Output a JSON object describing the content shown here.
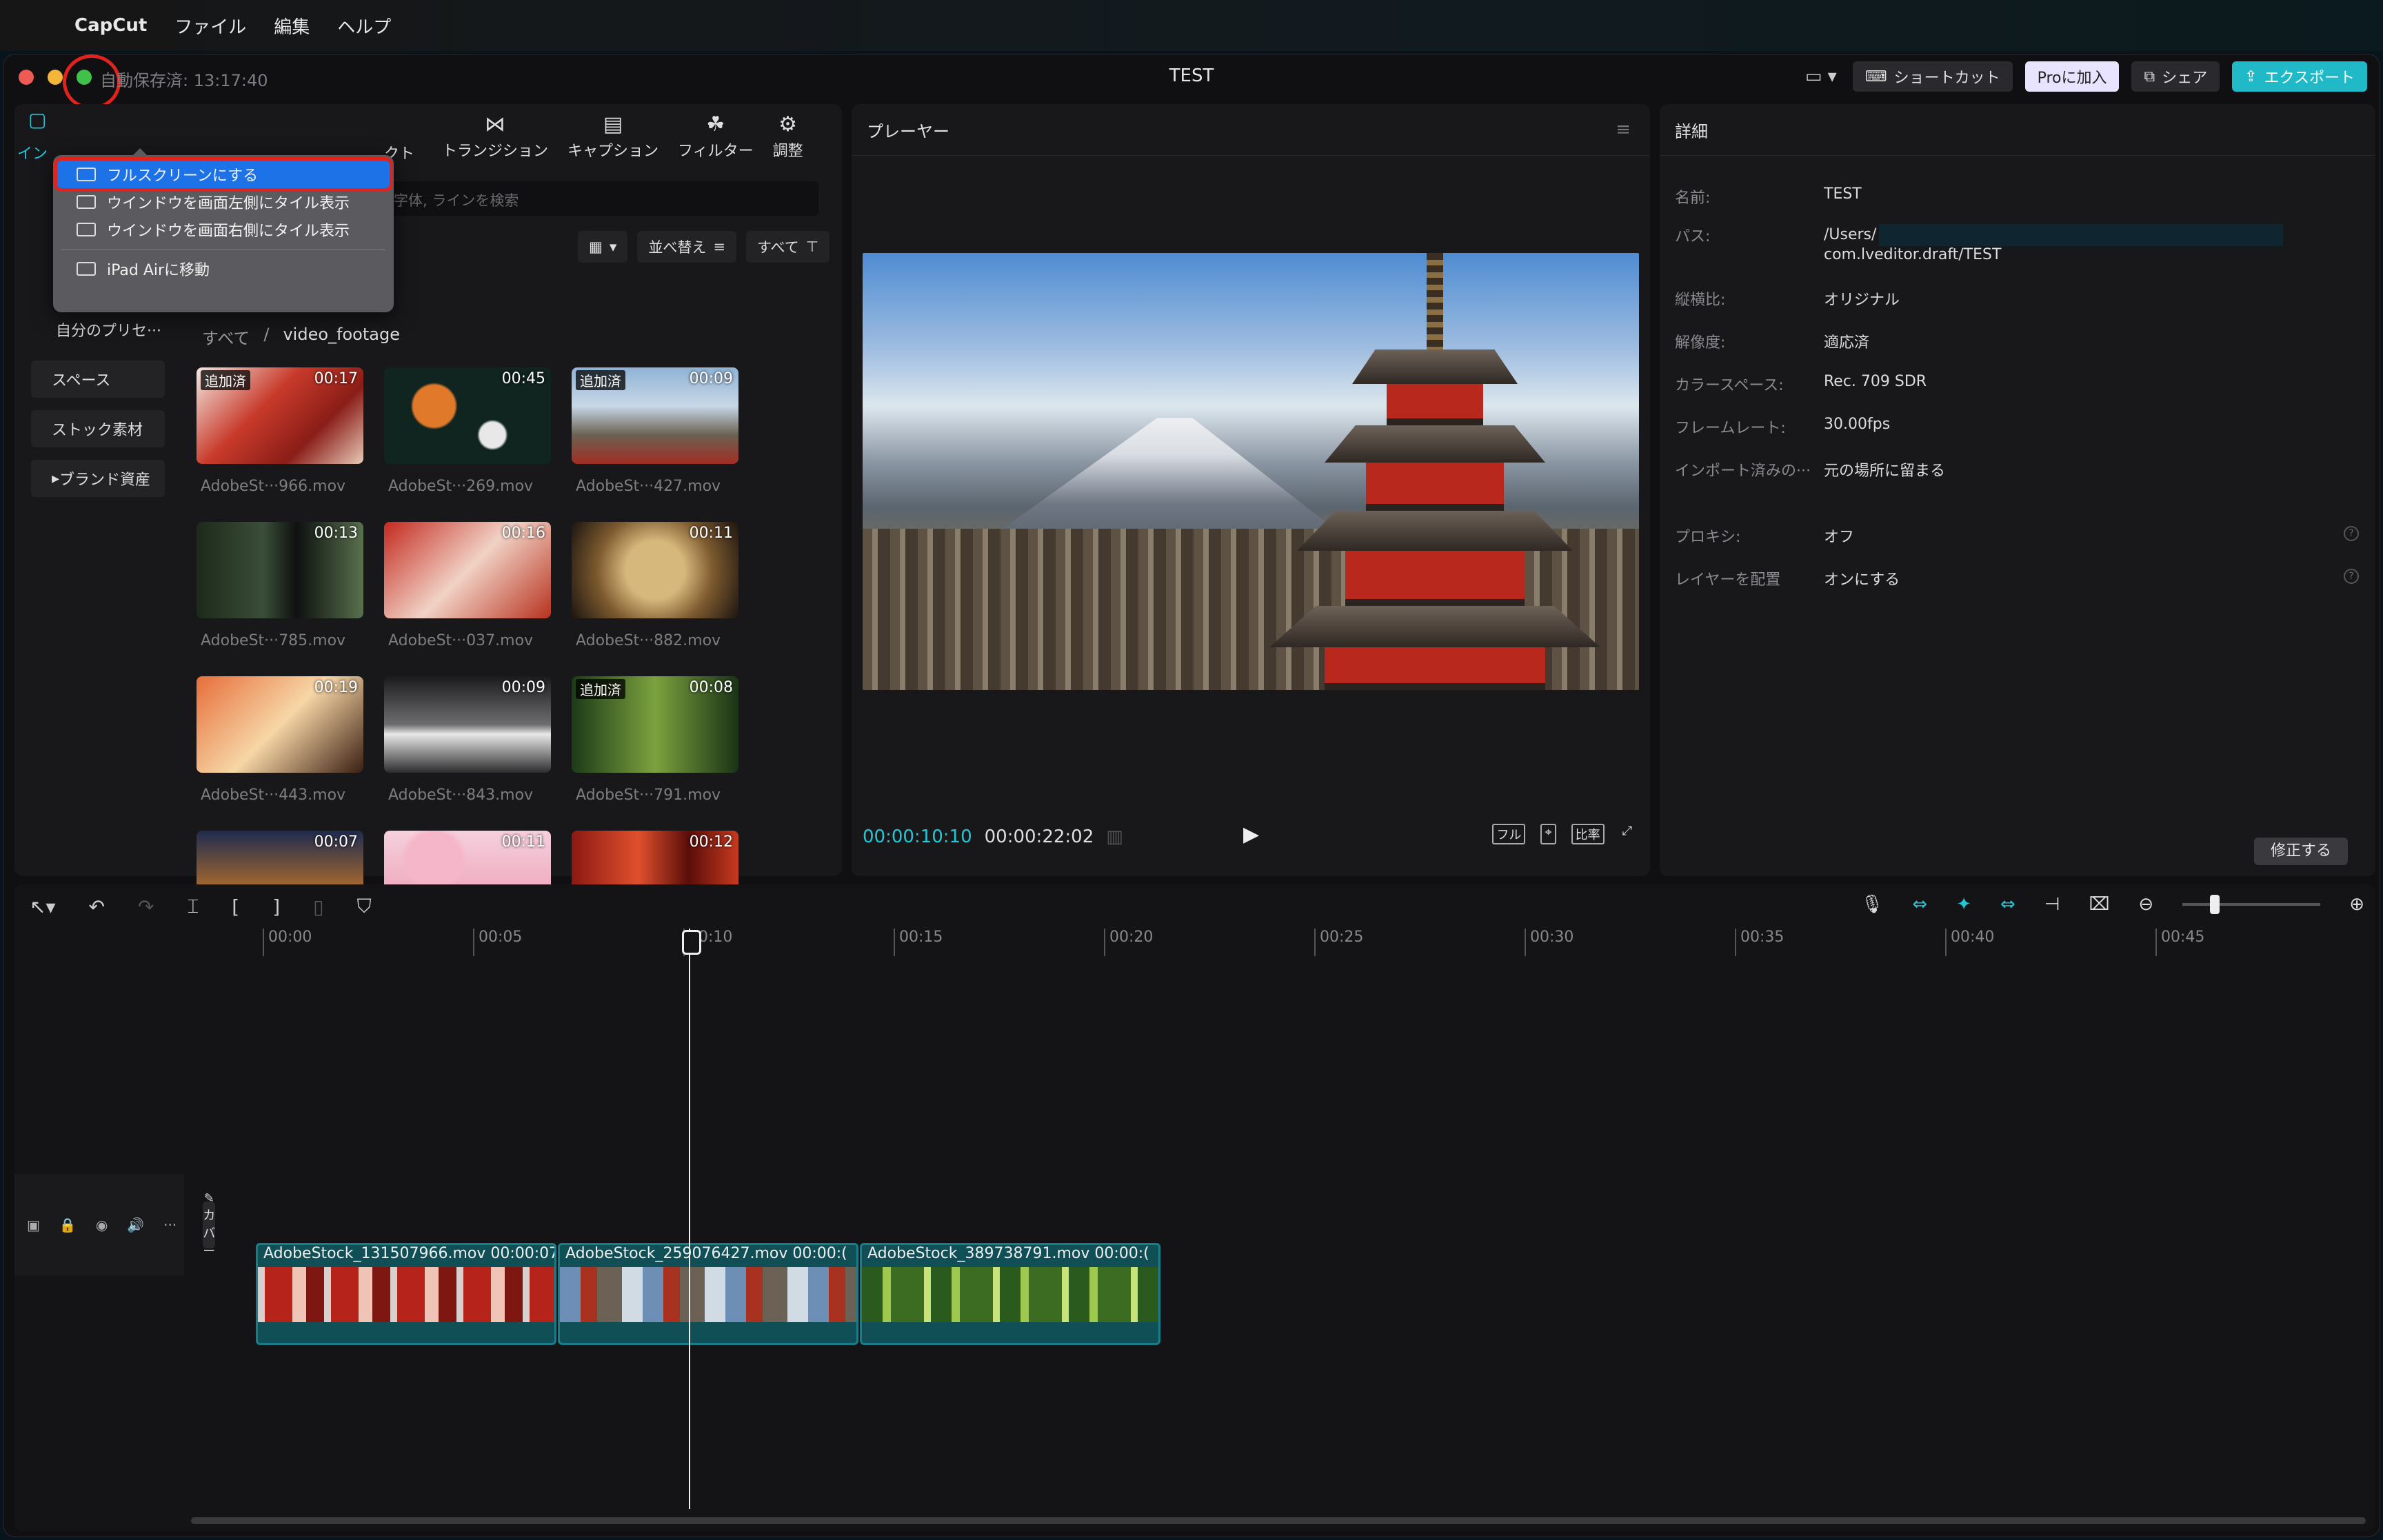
{
  "menubar": {
    "app_name": "CapCut",
    "items": [
      "ファイル",
      "編集",
      "ヘルプ"
    ]
  },
  "titlebar": {
    "autosave": "自動保存済: 13:17:40",
    "title": "TEST",
    "shortcut": "ショートカット",
    "pro": "Proに加入",
    "share": "シェア",
    "export": "エクスポート"
  },
  "window_menu": {
    "items": [
      {
        "label": "フルスクリーンにする",
        "active": true
      },
      {
        "label": "ウインドウを画面左側にタイル表示",
        "active": false
      },
      {
        "label": "ウインドウを画面右側にタイル表示",
        "active": false
      },
      {
        "label": "iPad Airに移動",
        "active": false
      }
    ]
  },
  "media_panel": {
    "tabs": [
      {
        "label": "トランジション",
        "icon": "transition-icon"
      },
      {
        "label": "キャプション",
        "icon": "caption-icon"
      },
      {
        "label": "フィルター",
        "icon": "filter-icon"
      },
      {
        "label": "調整",
        "icon": "adjust-icon"
      }
    ],
    "partial_tab_left": "イン",
    "partial_tab_mid": "クト",
    "search_placeholder": "字体, ラインを検索",
    "view_btn": "▾",
    "sort_btn": "並べ替え",
    "filter_btn": "すべて",
    "sidebar": [
      "自分のプリセ···",
      "スペース",
      "ストック素材",
      "ブランド資産"
    ],
    "crumbs": [
      "すべて",
      "video_footage"
    ],
    "clips": [
      {
        "badge": "追加済",
        "dur": "00:17",
        "name": "AdobeSt···966.mov"
      },
      {
        "badge": "",
        "dur": "00:45",
        "name": "AdobeSt···269.mov"
      },
      {
        "badge": "追加済",
        "dur": "00:09",
        "name": "AdobeSt···427.mov"
      },
      {
        "badge": "",
        "dur": "00:13",
        "name": "AdobeSt···785.mov"
      },
      {
        "badge": "",
        "dur": "00:16",
        "name": "AdobeSt···037.mov"
      },
      {
        "badge": "",
        "dur": "00:11",
        "name": "AdobeSt···882.mov"
      },
      {
        "badge": "",
        "dur": "00:19",
        "name": "AdobeSt···443.mov"
      },
      {
        "badge": "",
        "dur": "00:09",
        "name": "AdobeSt···843.mov"
      },
      {
        "badge": "追加済",
        "dur": "00:08",
        "name": "AdobeSt···791.mov"
      },
      {
        "badge": "",
        "dur": "00:07",
        "name": ""
      },
      {
        "badge": "",
        "dur": "00:11",
        "name": ""
      },
      {
        "badge": "",
        "dur": "00:12",
        "name": ""
      }
    ]
  },
  "player": {
    "title": "プレーヤー",
    "current": "00:00:10:10",
    "total": "00:00:22:02",
    "ctrl_full": "フル",
    "ctrl_ratio": "比率"
  },
  "details": {
    "title": "詳細",
    "rows": [
      {
        "k": "名前:",
        "v": "TEST"
      },
      {
        "k": "パス:",
        "v": "/Users/",
        "v2": "com.lveditor.draft/TEST"
      },
      {
        "k": "縦横比:",
        "v": "オリジナル"
      },
      {
        "k": "解像度:",
        "v": "適応済"
      },
      {
        "k": "カラースペース:",
        "v": "Rec. 709 SDR"
      },
      {
        "k": "フレームレート:",
        "v": "30.00fps"
      },
      {
        "k": "インポート済みの···",
        "v": "元の場所に留まる"
      },
      {
        "k": "プロキシ:",
        "v": "オフ"
      },
      {
        "k": "レイヤーを配置",
        "v": "オンにする"
      }
    ],
    "modify": "修正する"
  },
  "timeline": {
    "ruler": [
      "00:00",
      "00:05",
      "00:10",
      "00:15",
      "00:20",
      "00:25",
      "00:30",
      "00:35",
      "00:40",
      "00:45"
    ],
    "cover": "カバー",
    "clips": [
      {
        "name": "AdobeStock_131507966.mov",
        "dur": "00:00:07:"
      },
      {
        "name": "AdobeStock_259076427.mov",
        "dur": "00:00:("
      },
      {
        "name": "AdobeStock_389738791.mov",
        "dur": "00:00:("
      }
    ]
  },
  "colors": {
    "accent": "#22c7d6",
    "export": "#1fb9c8",
    "menu_highlight": "#1d72e8",
    "annotation": "#e0231d"
  }
}
